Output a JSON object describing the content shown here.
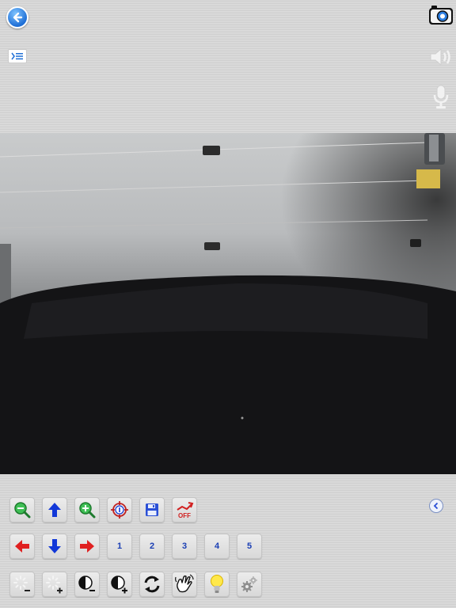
{
  "top": {
    "back_icon": "back-arrow-icon",
    "snapshot_icon": "camera-icon",
    "menu_icon": "menu-icon",
    "speaker_icon": "speaker-icon",
    "mic_icon": "microphone-icon"
  },
  "toolbar": {
    "presets": [
      "1",
      "2",
      "3",
      "4",
      "5"
    ],
    "collapse_icon": "chevron-left-icon"
  },
  "colors": {
    "accent_blue": "#1f6fd6",
    "arrow_blue": "#1238d8",
    "arrow_red": "#e02020",
    "zoom_green": "#22a03a"
  }
}
